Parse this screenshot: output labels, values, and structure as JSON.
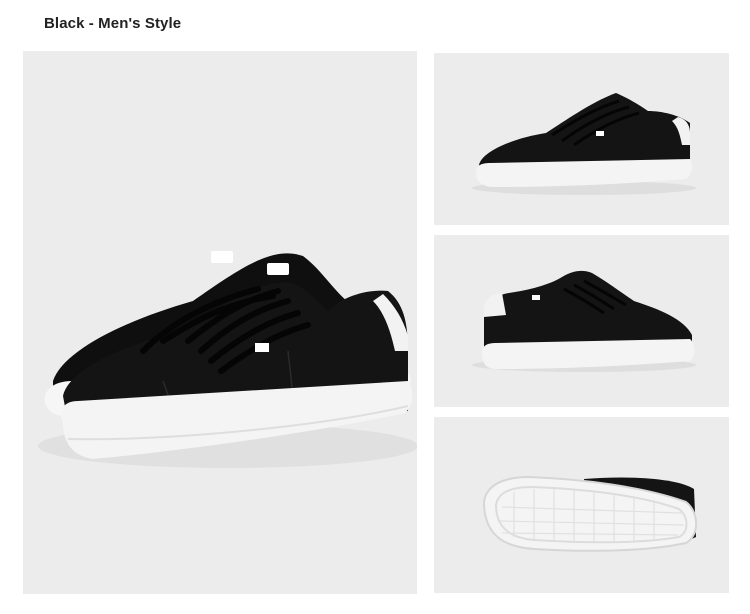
{
  "header": {
    "title": "Black - Men's Style"
  },
  "product": {
    "color_name": "Black",
    "style": "Men's Style"
  },
  "colors": {
    "panel_bg": "#ececec",
    "upper": "#141414",
    "sole": "#f4f4f4",
    "text": "#222222"
  },
  "gallery": [
    {
      "view": "three-quarter-front",
      "icon": "sneaker-main-photo"
    },
    {
      "view": "side-profile",
      "icon": "sneaker-side-photo"
    },
    {
      "view": "heel-three-quarter",
      "icon": "sneaker-heel-photo"
    },
    {
      "view": "outsole",
      "icon": "sneaker-sole-photo"
    }
  ]
}
